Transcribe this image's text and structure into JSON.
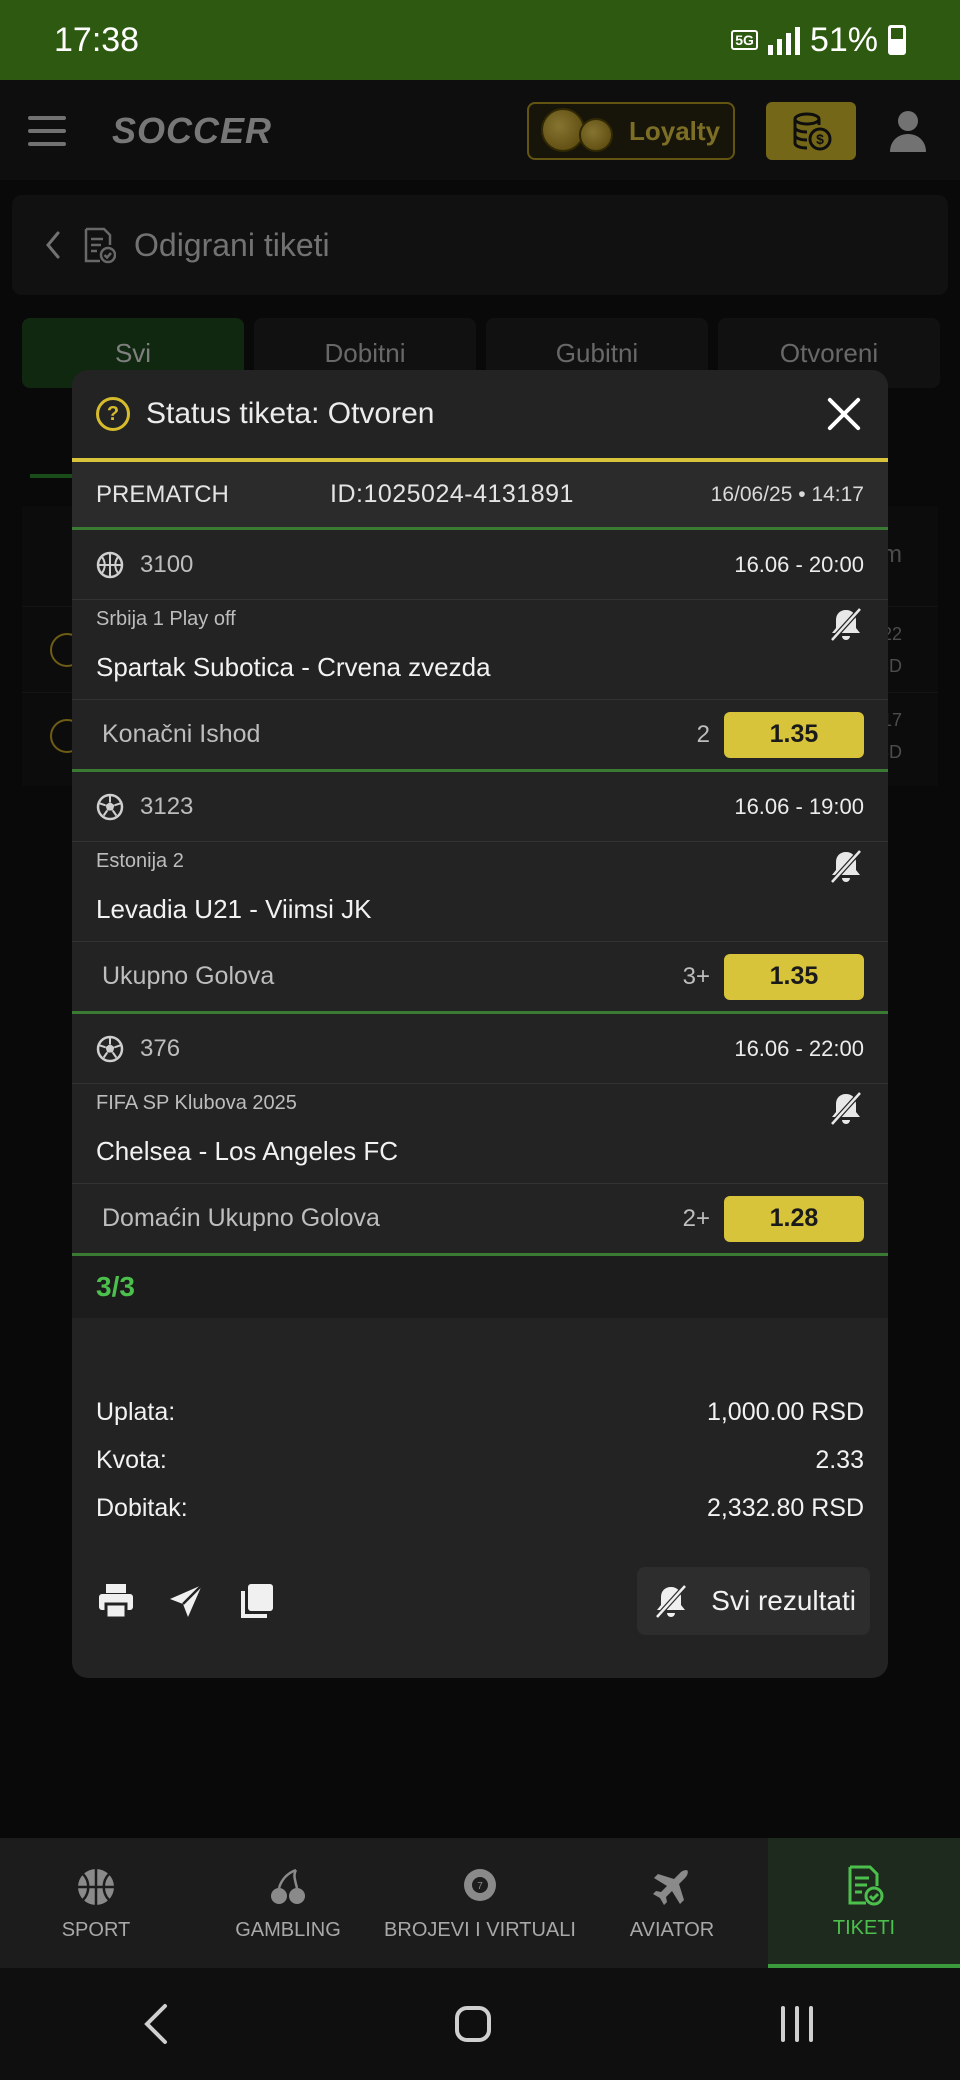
{
  "status_bar": {
    "time": "17:38",
    "network": "5G",
    "battery": "51%"
  },
  "header": {
    "logo": "SOCCER",
    "loyalty_label": "Loyalty"
  },
  "page": {
    "title": "Odigrani tiketi"
  },
  "filters": {
    "tabs": [
      "Svi",
      "Dobitni",
      "Gubitni",
      "Otvoreni"
    ],
    "active": "Svi"
  },
  "background_list": {
    "header_partial": "um",
    "rows": [
      {
        "time": "4:22",
        "currency": "RSD"
      },
      {
        "time": "4:17",
        "currency": "RSD"
      }
    ]
  },
  "modal": {
    "title": "Status tiketa: Otvoren",
    "type": "PREMATCH",
    "ticket_id": "ID:1025024-4131891",
    "datetime": "16/06/25 • 14:17",
    "events": [
      {
        "sport_icon": "basketball-icon",
        "code": "3100",
        "time": "16.06  -  20:00",
        "league": "Srbija 1 Play off",
        "match": "Spartak Subotica - Crvena zvezda",
        "market": "Konačni Ishod",
        "pick": "2",
        "odd": "1.35"
      },
      {
        "sport_icon": "soccer-ball-icon",
        "code": "3123",
        "time": "16.06  -  19:00",
        "league": "Estonija 2",
        "match": "Levadia U21 - Viimsi JK",
        "market": "Ukupno Golova",
        "pick": "3+",
        "odd": "1.35"
      },
      {
        "sport_icon": "soccer-ball-icon",
        "code": "376",
        "time": "16.06  -  22:00",
        "league": "FIFA SP Klubova 2025",
        "match": "Chelsea - Los Angeles FC",
        "market": "Domaćin Ukupno Golova",
        "pick": "2+",
        "odd": "1.28"
      }
    ],
    "count": "3/3",
    "summary": {
      "stake_label": "Uplata:",
      "stake_value": "1,000.00 RSD",
      "odds_label": "Kvota:",
      "odds_value": "2.33",
      "win_label": "Dobitak:",
      "win_value": "2,332.80 RSD"
    },
    "all_results_label": "Svi rezultati"
  },
  "bottom_nav": [
    {
      "label": "SPORT",
      "icon": "basketball-icon"
    },
    {
      "label": "GAMBLING",
      "icon": "cherries-icon"
    },
    {
      "label": "BROJEVI I VIRTUALI",
      "icon": "lottery-ball-icon"
    },
    {
      "label": "AVIATOR",
      "icon": "airplane-icon"
    },
    {
      "label": "TIKETI",
      "icon": "ticket-icon",
      "active": true
    }
  ],
  "colors": {
    "accent_yellow": "#d7c43a",
    "accent_green": "#3b7a32",
    "status_green": "#4cc04c"
  }
}
